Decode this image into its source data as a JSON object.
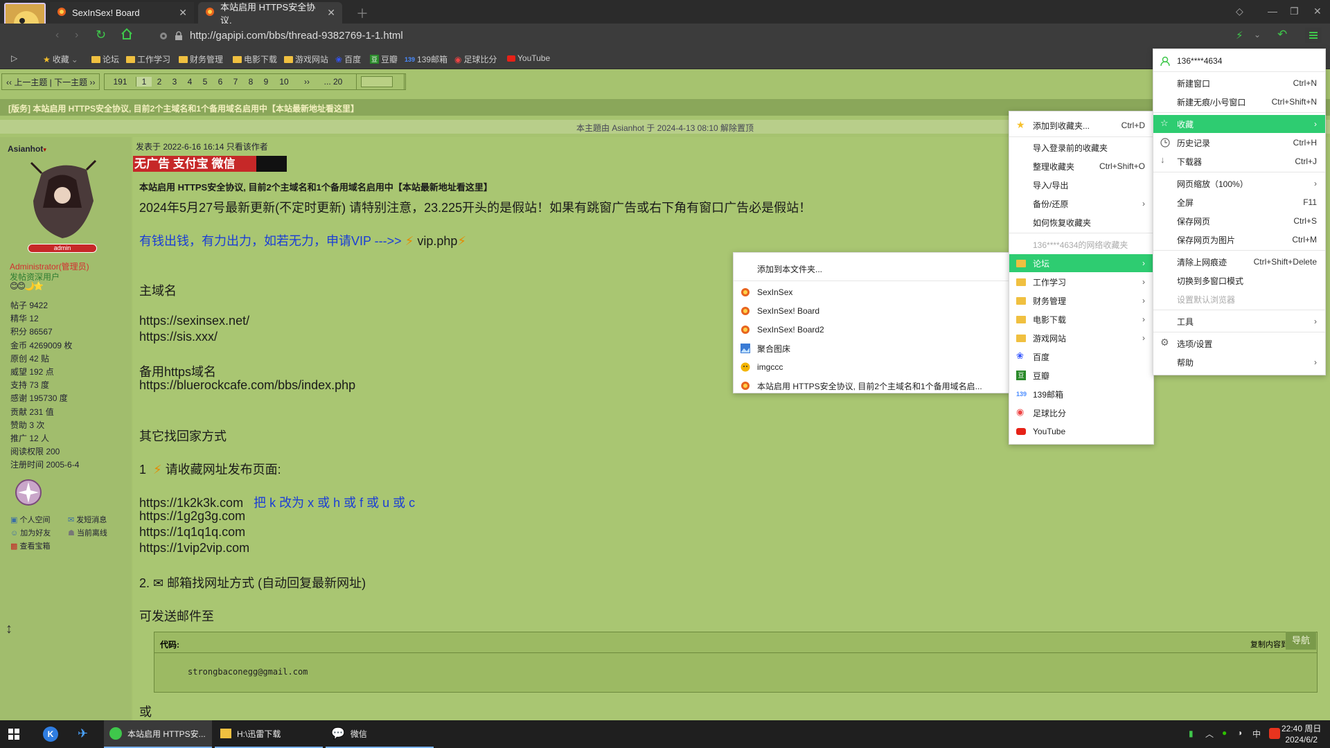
{
  "browser": {
    "tabs": [
      {
        "label": "SexInSex! Board"
      },
      {
        "label": "本站启用 HTTPS安全协议,"
      }
    ],
    "url": "http://gapipi.com/bbs/thread-9382769-1-1.html",
    "bookmarks": [
      "收藏",
      "论坛",
      "工作学习",
      "财务管理",
      "电影下载",
      "游戏网站",
      "百度",
      "豆瓣",
      "139邮箱",
      "足球比分",
      "YouTube"
    ]
  },
  "page": {
    "pager": {
      "prevnext": "‹‹ 上一主题 | 下一主题 ››",
      "pages": [
        "191",
        "1",
        "2",
        "3",
        "4",
        "5",
        "6",
        "7",
        "8",
        "9",
        "10",
        "››",
        "... 20"
      ]
    },
    "thread_title": "[版务] 本站启用 HTTPS安全协议, 目前2个主域名和1个备用域名启用中【本站最新地址看这里】",
    "topic_note": "本主題由 Asianhot 于 2024-4-13 08:10 解除置顶",
    "author": {
      "name": "Asianhot",
      "badge": "admin",
      "role": "Administrator(管理员)",
      "group": "发帖资深用户",
      "stats": [
        "帖子 9422",
        "精华 12",
        "积分 86567",
        "金币 4269009 枚",
        "原创 42 贴",
        "威望 192 点",
        "支持 73 度",
        "感谢 195730 度",
        "贡献 231 值",
        "赞助 3 次",
        "推广 12 人",
        "阅读权限 200",
        "注册时间 2005-6-4"
      ],
      "links": [
        "个人空间",
        "发短消息",
        "加为好友",
        "当前离线",
        "查看宝箱"
      ]
    },
    "post": {
      "meta": "发表于 2022-6-16 16:14  只看该作者",
      "banner": "无广告 支付宝 微信",
      "headline": "本站启用 HTTPS安全协议, 目前2个主域名和1个备用域名启用中【本站最新地址看这里】",
      "notice": "2024年5月27号最新更新(不定时更新) 请特别注意，23.225开头的是假站！如果有跳窗广告或右下角有窗口广告必是假站！",
      "vip_line": "有钱出钱，有力出力，如若无力，申请VIP --->>",
      "vip_link": "vip.php",
      "main_domain_label": "主域名",
      "main_domain_1": "https://sexinsex.net/",
      "main_domain_2": "https://sis.xxx/",
      "backup_label": "备用https域名",
      "backup_domain": "https://bluerockcafe.com/bbs/index.php",
      "other_ways": "其它找回家方式",
      "step1_num": "1",
      "step1_text": "请收藏网址发布页面:",
      "alt_1": "https://1k2k3k.com",
      "alt_hint": "把 k 改为 x 或 h 或 f 或 u 或 c",
      "alt_2": "https://1g2g3g.com",
      "alt_3": "https://1q1q1q.com",
      "alt_4": "https://1vip2vip.com",
      "step2_num": "2.",
      "step2_text": "邮箱找网址方式  (自动回复最新网址)",
      "send_to": "可发送邮件至",
      "code_label": "代码:",
      "code_copy": "复制内容到剪贴板",
      "code_text": "strongbaconegg@gmail.com",
      "or": "或",
      "nav": "导航"
    }
  },
  "main_menu": {
    "account": "136****4634",
    "items": [
      {
        "label": "新建窗口",
        "shortcut": "Ctrl+N"
      },
      {
        "label": "新建无痕/小号窗口",
        "shortcut": "Ctrl+Shift+N"
      },
      {
        "label": "收藏"
      },
      {
        "label": "历史记录",
        "shortcut": "Ctrl+H"
      },
      {
        "label": "下载器",
        "shortcut": "Ctrl+J"
      },
      {
        "label": "网页缩放（100%）"
      },
      {
        "label": "全屏",
        "shortcut": "F11"
      },
      {
        "label": "保存网页",
        "shortcut": "Ctrl+S"
      },
      {
        "label": "保存网页为图片",
        "shortcut": "Ctrl+M"
      },
      {
        "label": "清除上网痕迹",
        "shortcut": "Ctrl+Shift+Delete"
      },
      {
        "label": "切换到多窗口模式"
      },
      {
        "label": "设置默认浏览器"
      },
      {
        "label": "工具"
      },
      {
        "label": "选项/设置"
      },
      {
        "label": "帮助"
      }
    ]
  },
  "fav_menu": {
    "items": [
      {
        "label": "添加到收藏夹...",
        "shortcut": "Ctrl+D"
      },
      {
        "label": "导入登录前的收藏夹"
      },
      {
        "label": "整理收藏夹",
        "shortcut": "Ctrl+Shift+O"
      },
      {
        "label": "导入/导出"
      },
      {
        "label": "备份/还原"
      },
      {
        "label": "如何恢复收藏夹"
      },
      {
        "label": "136****4634的网络收藏夹"
      },
      {
        "label": "论坛"
      },
      {
        "label": "工作学习"
      },
      {
        "label": "财务管理"
      },
      {
        "label": "电影下载"
      },
      {
        "label": "游戏网站"
      },
      {
        "label": "百度"
      },
      {
        "label": "豆瓣"
      },
      {
        "label": "139邮箱"
      },
      {
        "label": "足球比分"
      },
      {
        "label": "YouTube"
      }
    ]
  },
  "forum_menu": {
    "items": [
      {
        "label": "添加到本文件夹..."
      },
      {
        "label": "SexInSex"
      },
      {
        "label": "SexInSex! Board"
      },
      {
        "label": "SexInSex! Board2"
      },
      {
        "label": "聚合图床"
      },
      {
        "label": "imgccc"
      },
      {
        "label": "本站启用 HTTPS安全协议, 目前2个主域名和1个备用域名启..."
      }
    ]
  },
  "taskbar": {
    "apps": [
      "本站启用 HTTPS安...",
      "H:\\迅雷下载",
      "微信"
    ],
    "ime": "中",
    "time": "22:40 周日",
    "date": "2024/6/2"
  },
  "colors": {
    "page_bg": "#a6c36f",
    "menu_highlight": "#2ecc71",
    "link_blue": "#1a3dd6",
    "titlebar": "#2b2b2b"
  }
}
